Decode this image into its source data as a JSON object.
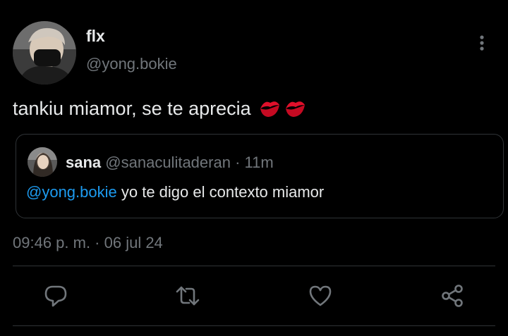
{
  "author": {
    "name": "flx",
    "handle": "@yong.bokie"
  },
  "tweet": {
    "text": "tankiu miamor, se te aprecia",
    "emoji_icons": [
      "kiss-mark-icon",
      "kiss-mark-icon"
    ]
  },
  "quoted": {
    "name": "sana",
    "handle": "@sanaculitaderan",
    "separator": "·",
    "time": "11m",
    "mention": "@yong.bokie",
    "text": "yo te digo el contexto miamor"
  },
  "timestamp": "09:46 p. m. · 06 jul 24",
  "actions": [
    "reply-icon",
    "retweet-icon",
    "like-icon",
    "share-icon"
  ],
  "colors": {
    "background": "#000000",
    "primary_text": "#e7e9ea",
    "secondary_text": "#71767b",
    "link": "#1d9bf0",
    "border": "#2f3336"
  }
}
